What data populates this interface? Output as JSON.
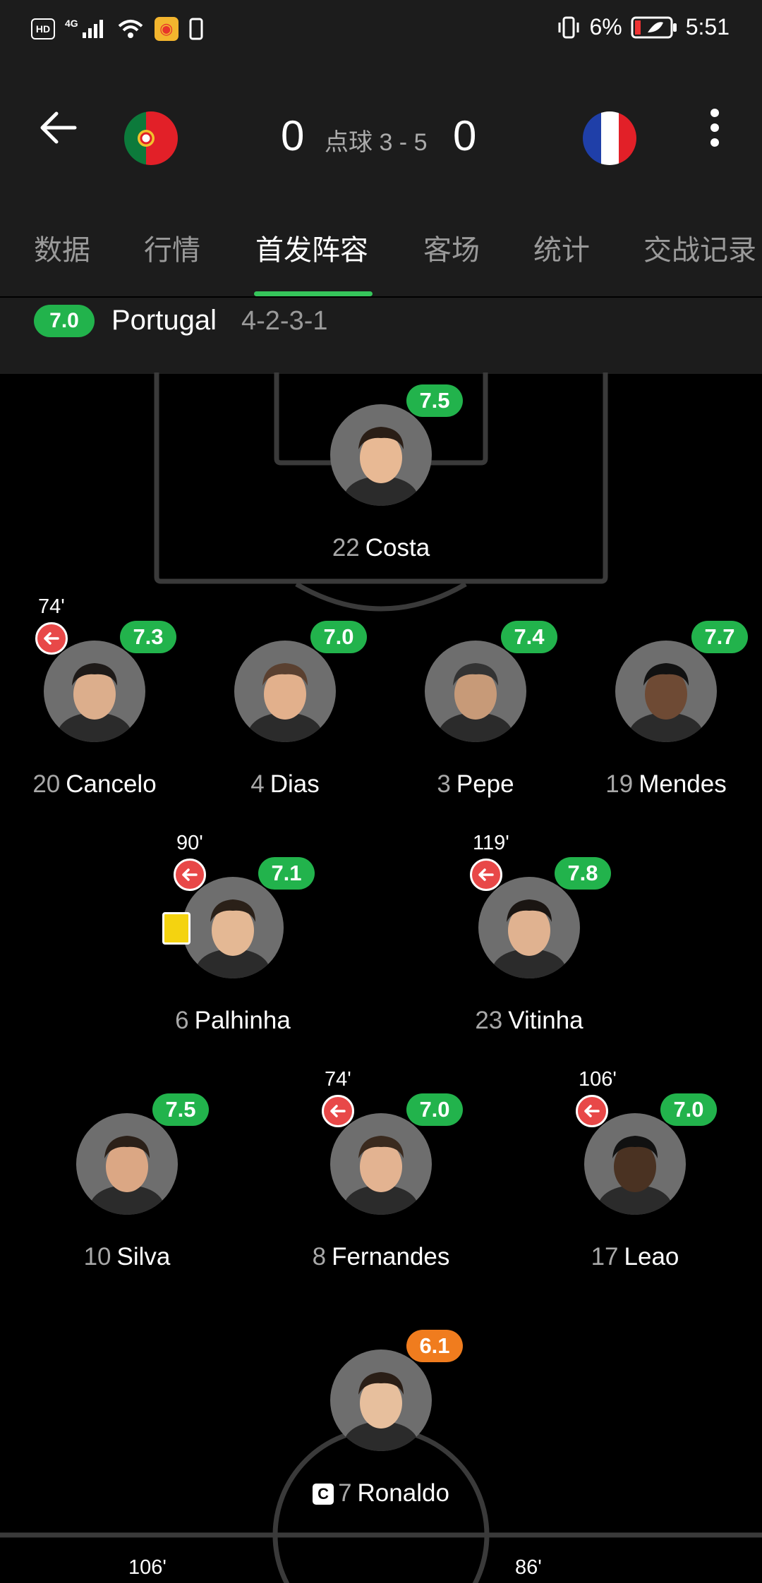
{
  "status_bar": {
    "network": "4G",
    "battery_percent": "6%",
    "time": "5:51"
  },
  "header": {
    "home_score": "0",
    "penalty_text": "点球 3 - 5",
    "away_score": "0"
  },
  "tabs": [
    "数据",
    "行情",
    "首发阵容",
    "客场",
    "统计",
    "交战记录"
  ],
  "active_tab_index": 2,
  "team": {
    "rating": "7.0",
    "name": "Portugal",
    "formation": "4-2-3-1"
  },
  "players": [
    {
      "number": "22",
      "name": "Costa",
      "rating": "7.5"
    },
    {
      "number": "20",
      "name": "Cancelo",
      "rating": "7.3",
      "sub_minute": "74'"
    },
    {
      "number": "4",
      "name": "Dias",
      "rating": "7.0"
    },
    {
      "number": "3",
      "name": "Pepe",
      "rating": "7.4"
    },
    {
      "number": "19",
      "name": "Mendes",
      "rating": "7.7"
    },
    {
      "number": "6",
      "name": "Palhinha",
      "rating": "7.1",
      "sub_minute": "90'",
      "yellow_card": true
    },
    {
      "number": "23",
      "name": "Vitinha",
      "rating": "7.8",
      "sub_minute": "119'"
    },
    {
      "number": "10",
      "name": "Silva",
      "rating": "7.5"
    },
    {
      "number": "8",
      "name": "Fernandes",
      "rating": "7.0",
      "sub_minute": "74'"
    },
    {
      "number": "17",
      "name": "Leao",
      "rating": "7.0",
      "sub_minute": "106'"
    },
    {
      "number": "7",
      "name": "Ronaldo",
      "rating": "6.1",
      "captain": true,
      "captain_badge": "C"
    }
  ],
  "bottom_minutes": [
    "106'",
    "86'"
  ],
  "colors": {
    "rating_green": "#22b34c",
    "rating_orange": "#f07c1e",
    "sub_red": "#e84848",
    "yellow_card": "#f4d310",
    "tab_underline": "#36c55b"
  }
}
